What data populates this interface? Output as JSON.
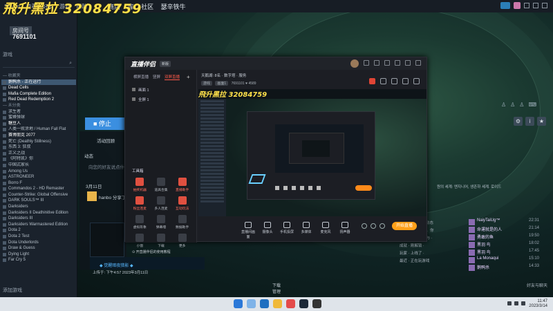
{
  "overlay": {
    "title": "飛升黑拉 32084759"
  },
  "steam": {
    "menu": [
      "Steam",
      "查看",
      "好友",
      "游戏",
      "帮助"
    ],
    "nav": [
      "商店",
      "库",
      "社区",
      "瑟辛铁牛"
    ],
    "room_label": "房间号",
    "room_number": "7691101",
    "filter_label": "游戏",
    "games": [
      {
        "name": "— 收藏夹",
        "type": "hdr"
      },
      {
        "name": "鹅鸭杀 - 正在运行",
        "type": "sel"
      },
      {
        "name": "Dead Cells",
        "type": "w"
      },
      {
        "name": "Mafia Complete Edition",
        "type": "w"
      },
      {
        "name": "Red Dead Redemption 2",
        "type": "w"
      },
      {
        "name": "— 未分类",
        "type": "hdr"
      },
      {
        "name": "求生者",
        "type": ""
      },
      {
        "name": "蜜蜂弹球",
        "type": ""
      },
      {
        "name": "糖豆人",
        "type": "w"
      },
      {
        "name": "人类一败涂地 / Human Fall Flat",
        "type": ""
      },
      {
        "name": "赛博朋克 2077",
        "type": "w"
      },
      {
        "name": "死亡 (Deathly Stillness)",
        "type": ""
      },
      {
        "name": "东西 3: 狂叔",
        "type": ""
      },
      {
        "name": "正义之战",
        "type": ""
      },
      {
        "name": "《阿特凯》你",
        "type": ""
      },
      {
        "name": "中国式家长",
        "type": ""
      },
      {
        "name": "Among Us",
        "type": ""
      },
      {
        "name": "ASTRONEER",
        "type": ""
      },
      {
        "name": "Borro F",
        "type": ""
      },
      {
        "name": "Commandos 2 - HD Remaster",
        "type": ""
      },
      {
        "name": "Counter-Strike: Global Offensive",
        "type": ""
      },
      {
        "name": "DARK SOULS™ III",
        "type": ""
      },
      {
        "name": "Darksiders",
        "type": ""
      },
      {
        "name": "Darksiders II Deathinitive Edition",
        "type": ""
      },
      {
        "name": "Darksiders III",
        "type": ""
      },
      {
        "name": "Darksiders Warmastered Edition",
        "type": ""
      },
      {
        "name": "Dota 2",
        "type": ""
      },
      {
        "name": "Dota 2 Test",
        "type": ""
      },
      {
        "name": "Dota Underlords",
        "type": ""
      },
      {
        "name": "Draw & Guess",
        "type": ""
      },
      {
        "name": "Dying Light",
        "type": ""
      },
      {
        "name": "Far Cry 5",
        "type": ""
      }
    ],
    "add_game": "添加游戏",
    "stop_label": "■ 停止",
    "tab_label": "活动回顾",
    "activity_heading": "动态",
    "activity_placeholder": "向您的好友说点什么...",
    "date_label": "3月11日",
    "hanbo_text": "hanbo 分享了",
    "promo_text": "◆ 觉醒暗夜猎影 ◆",
    "upload_time": "上传于: 下午4:57 2023年3月11日",
    "download_label": "下载",
    "download_sub": "管理",
    "friends_label": "好友与聊天",
    "korean_text": "원의 세계: 엔지니어, 생존하 세계. 로이드",
    "activities": [
      "玩家 · 发布了新动态",
      "成功通关了活动，你",
      "好友截图，你参与 ·",
      "成就 · 刚解锁 ·",
      "玩家 · 上线了 ·",
      "最近 · 正在玩游戏"
    ],
    "friends": [
      {
        "name": "NaiyTaiUg™",
        "time": "22:31"
      },
      {
        "name": "命運就是的人",
        "time": "21:14"
      },
      {
        "name": "勇敢的鱼",
        "time": "19:50"
      },
      {
        "name": "黑羽 鸟",
        "time": "18:02"
      },
      {
        "name": "黑羽 鸟",
        "time": "17:45"
      },
      {
        "name": "La Monaqui",
        "time": "15:10"
      },
      {
        "name": "鹅鸭杀",
        "time": "14:33"
      }
    ]
  },
  "zhibo": {
    "logo": "直播伴侣",
    "version": "新版",
    "tabs": [
      "横屏直播",
      "竖屏",
      "双屏直播"
    ],
    "scenes": [
      "画面 1",
      "全屏 1"
    ],
    "tools_title": "工具箱",
    "tools": [
      {
        "name": "抽奖机器",
        "red": true
      },
      {
        "name": "道具合集",
        "red": false
      },
      {
        "name": "直播助手",
        "red": true
      },
      {
        "name": "粉丝连麦",
        "red": true
      },
      {
        "name": "多人连麦",
        "red": false
      },
      {
        "name": "互动玩法",
        "red": true
      },
      {
        "name": "虚拟形象",
        "red": false
      },
      {
        "name": "弹幕墙",
        "red": false
      },
      {
        "name": "数据助手",
        "red": false
      },
      {
        "name": "小窗",
        "red": false
      },
      {
        "name": "下载",
        "red": false
      },
      {
        "name": "更多",
        "red": false
      }
    ],
    "tools_foot": "⊙ 开直播伴侣的使用教程",
    "info_title": "天鹅湖: 8名 · 数字塔 · 服务",
    "info_chip1": "游戏",
    "info_chip2": "画面1",
    "info_room": "7691101",
    "info_fans": "4589",
    "bottom_buttons": [
      "直播间画面",
      "摄像头",
      "手机投屏",
      "多媒体",
      "麦克风",
      "扬声器"
    ],
    "go_live": "开始直播"
  },
  "taskbar": {
    "time": "11:47",
    "date": "2023/3/14"
  },
  "colors": {
    "accent": "#3b8fe0",
    "live": "#ffa019",
    "overlay": "#ffe14a"
  }
}
